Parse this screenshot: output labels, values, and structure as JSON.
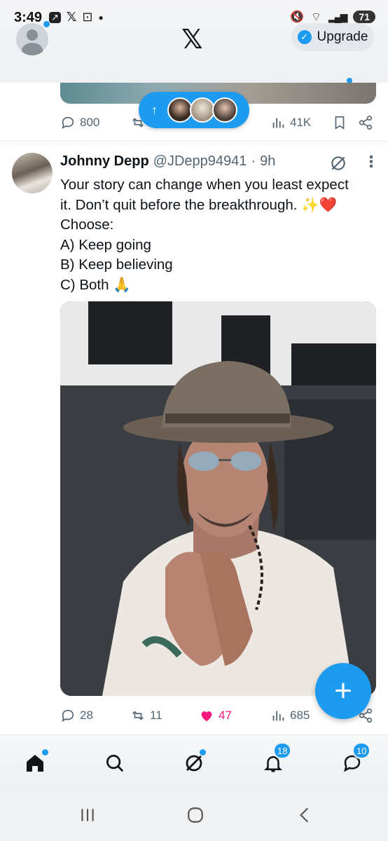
{
  "status_bar": {
    "time": "3:49",
    "battery": "71",
    "signal_label": "5"
  },
  "top_bar": {
    "logo": "𝕏",
    "upgrade_label": "Upgrade"
  },
  "new_posts_pill": {
    "arrow": "↑"
  },
  "prev_tweet": {
    "replies": "800",
    "views": "41K"
  },
  "tweet": {
    "name": "Johnny Depp",
    "handle": "@JDepp94941",
    "separator": "·",
    "time": "9h",
    "lines": [
      "Your story can change when you least expect",
      "it. Don’t quit before the breakthrough. ✨❤️",
      "Choose:",
      "A) Keep going",
      "B) Keep believing",
      " C) Both 🙏"
    ],
    "replies": "28",
    "reposts": "11",
    "likes": "47",
    "views": "685"
  },
  "fab": {
    "label": "+"
  },
  "bottom_nav": {
    "notifications_badge": "18",
    "messages_badge": "10"
  },
  "colors": {
    "accent": "#1d9bf0",
    "like": "#f91880",
    "secondary_text": "#536471"
  }
}
